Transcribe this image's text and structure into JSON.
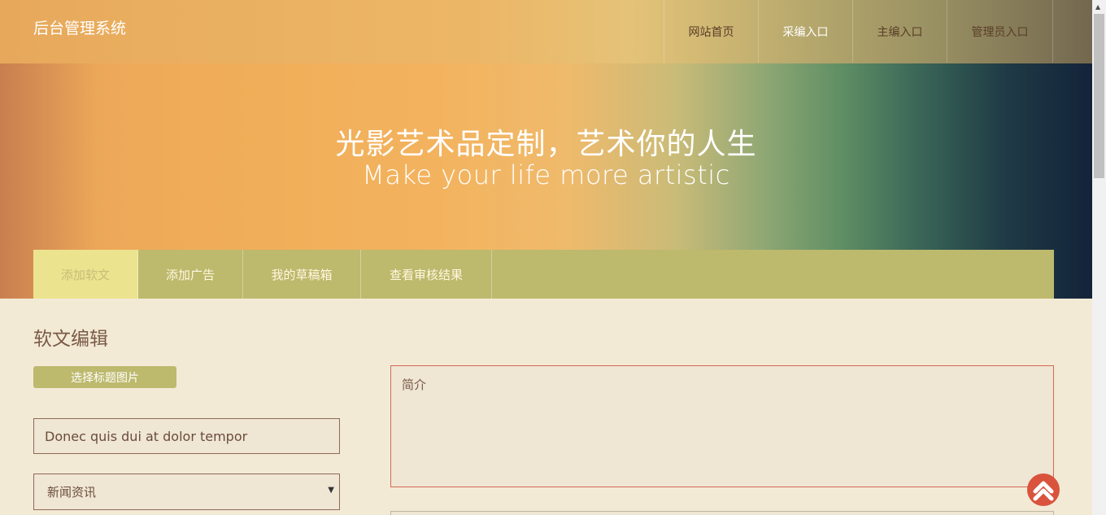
{
  "header": {
    "brand": "后台管理系统",
    "nav": [
      {
        "label": "网站首页"
      },
      {
        "label": "采编入口"
      },
      {
        "label": "主编入口"
      },
      {
        "label": "管理员入口"
      }
    ]
  },
  "hero": {
    "title": "光影艺术品定制，艺术你的人生",
    "subtitle": "Make your life more artistic"
  },
  "tabs": [
    {
      "label": "添加软文"
    },
    {
      "label": "添加广告"
    },
    {
      "label": "我的草稿箱"
    },
    {
      "label": "查看审核结果"
    }
  ],
  "editor": {
    "section_title": "软文编辑",
    "pick_image_button": "选择标题图片",
    "title_value": "Donec quis dui at dolor tempor",
    "category_selected": "新闻资讯",
    "summary_placeholder": "简介"
  },
  "colors": {
    "tab_bar": "#bdb96d",
    "tab_active": "#ece38f",
    "accent_border": "#d46a54",
    "back_to_top": "#d9533d"
  },
  "icons": {
    "back_to_top": "double-chevron-up-icon",
    "select_arrow": "caret-down-icon"
  }
}
